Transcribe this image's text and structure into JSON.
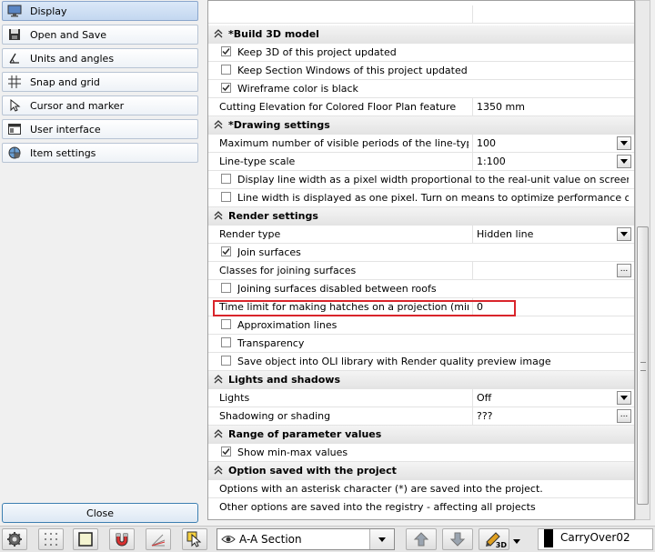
{
  "nav": {
    "items": [
      {
        "label": "Display",
        "icon": "monitor-icon",
        "active": true
      },
      {
        "label": "Open and Save",
        "icon": "save-icon"
      },
      {
        "label": "Units and angles",
        "icon": "angle-icon"
      },
      {
        "label": "Snap and grid",
        "icon": "grid-icon"
      },
      {
        "label": "Cursor and marker",
        "icon": "cursor-icon"
      },
      {
        "label": "User interface",
        "icon": "window-icon"
      },
      {
        "label": "Item settings",
        "icon": "globe-gear-icon"
      }
    ],
    "close_label": "Close"
  },
  "grid": {
    "build3d": {
      "title": "*Build 3D model",
      "keep3d": {
        "label": "Keep 3D of this project updated",
        "checked": true
      },
      "keep_section": {
        "label": "Keep Section Windows of this project updated",
        "checked": false
      },
      "wireframe": {
        "label": "Wireframe color is black",
        "checked": true
      },
      "cutting": {
        "label": "Cutting Elevation for Colored Floor Plan feature",
        "value": "1350 mm"
      }
    },
    "drawing": {
      "title": "*Drawing settings",
      "max_periods": {
        "label": "Maximum number of visible periods of the line-type p...",
        "value": "100"
      },
      "linetype_scale": {
        "label": "Line-type scale",
        "value": "1:100"
      },
      "line_width_prop": {
        "label": "Display line width as a pixel width proportional to the real-unit value on screen",
        "checked": false
      },
      "line_width_one": {
        "label": "Line width is displayed as one pixel. Turn on means to optimize performance on screen.",
        "checked": false
      }
    },
    "render": {
      "title": "Render settings",
      "render_type": {
        "label": "Render type",
        "value": "Hidden line"
      },
      "join_surfaces": {
        "label": "Join surfaces",
        "checked": true
      },
      "classes": {
        "label": "Classes for joining surfaces",
        "value": ""
      },
      "joining_roofs": {
        "label": "Joining surfaces disabled between roofs",
        "checked": false
      },
      "time_limit": {
        "label": "Time limit for making hatches on a projection (minutes)",
        "value": "0"
      },
      "approx": {
        "label": "Approximation lines",
        "checked": false
      },
      "transparency": {
        "label": "Transparency",
        "checked": false
      },
      "save_oli": {
        "label": "Save object into OLI library with Render quality preview image",
        "checked": false
      }
    },
    "lights": {
      "title": "Lights and shadows",
      "lights": {
        "label": "Lights",
        "value": "Off"
      },
      "shadowing": {
        "label": "Shadowing or shading",
        "value": "???"
      }
    },
    "range": {
      "title": "Range of parameter values",
      "show_minmax": {
        "label": "Show min-max values",
        "checked": true
      }
    },
    "option_saved": {
      "title": "Option saved with the project",
      "line1": "Options with an asterisk character (*) are saved into the project.",
      "line2": "Other options are saved into the registry - affecting all projects"
    }
  },
  "toolbar": {
    "section_label": "A-A Section",
    "layer_name": "CarryOver02",
    "badge_3d": "3D"
  }
}
